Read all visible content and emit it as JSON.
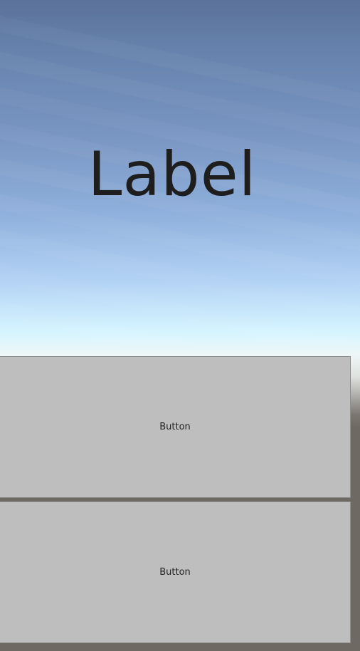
{
  "scene": {
    "label_text": "Label"
  },
  "buttons": [
    {
      "label": "Button"
    },
    {
      "label": "Button"
    }
  ],
  "colors": {
    "sky_top": "#5b7299",
    "sky_horizon": "#d7f5ff",
    "ground": "#6f6963",
    "button_bg": "#bebebe",
    "label_text": "#1e1e1e"
  }
}
